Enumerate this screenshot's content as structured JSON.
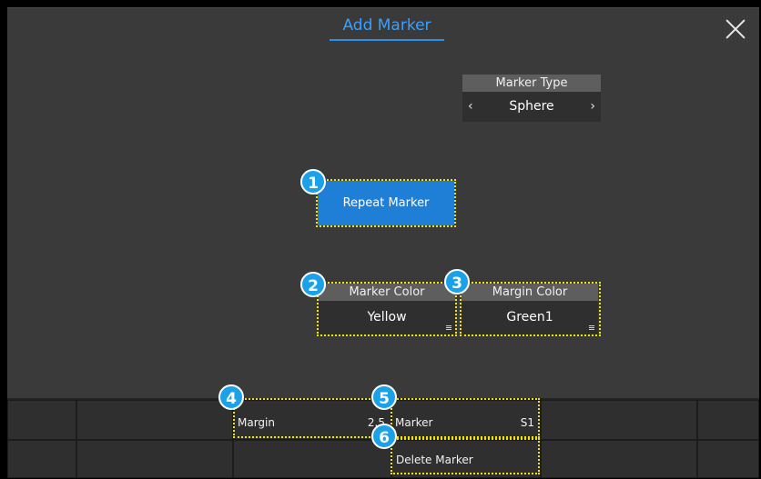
{
  "dialog": {
    "title": "Add Marker"
  },
  "marker_type": {
    "label": "Marker Type",
    "value": "Sphere",
    "prev_icon": "chevron-left-icon",
    "next_icon": "chevron-right-icon"
  },
  "repeat_marker": {
    "label": "Repeat Marker"
  },
  "marker_color": {
    "label": "Marker Color",
    "value": "Yellow"
  },
  "margin_color": {
    "label": "Margin Color",
    "value": "Green1"
  },
  "softkeys": {
    "margin": {
      "label": "Margin",
      "value": "2.5"
    },
    "marker": {
      "label": "Marker",
      "value": "S1"
    },
    "delete_marker": {
      "label": "Delete Marker"
    }
  },
  "callouts": [
    "1",
    "2",
    "3",
    "4",
    "5",
    "6"
  ],
  "colors": {
    "accent": "#1f7fd6",
    "title": "#3aa0ff",
    "highlight": "#f2e600",
    "badge": "#1aa1e8"
  }
}
